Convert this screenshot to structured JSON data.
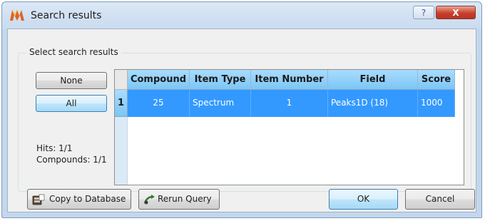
{
  "window": {
    "title": "Search results",
    "help_label": "?",
    "close_label": "X"
  },
  "group": {
    "label": "Select search results"
  },
  "selection": {
    "none_label": "None",
    "all_label": "All"
  },
  "stats": {
    "hits": "Hits: 1/1",
    "compounds": "Compounds: 1/1"
  },
  "table": {
    "columns": [
      "Compound",
      "Item Type",
      "Item Number",
      "Field",
      "Score"
    ],
    "rows": [
      {
        "row_number": "1",
        "cells": [
          "25",
          "Spectrum",
          "1",
          "Peaks1D (18)",
          "1000"
        ]
      }
    ]
  },
  "footer": {
    "copy_label": "Copy to Database",
    "rerun_label": "Rerun Query",
    "ok_label": "OK",
    "cancel_label": "Cancel"
  },
  "colors": {
    "selection": "#3399ff",
    "header": "#8fcff8",
    "close_button": "#c9402b"
  }
}
